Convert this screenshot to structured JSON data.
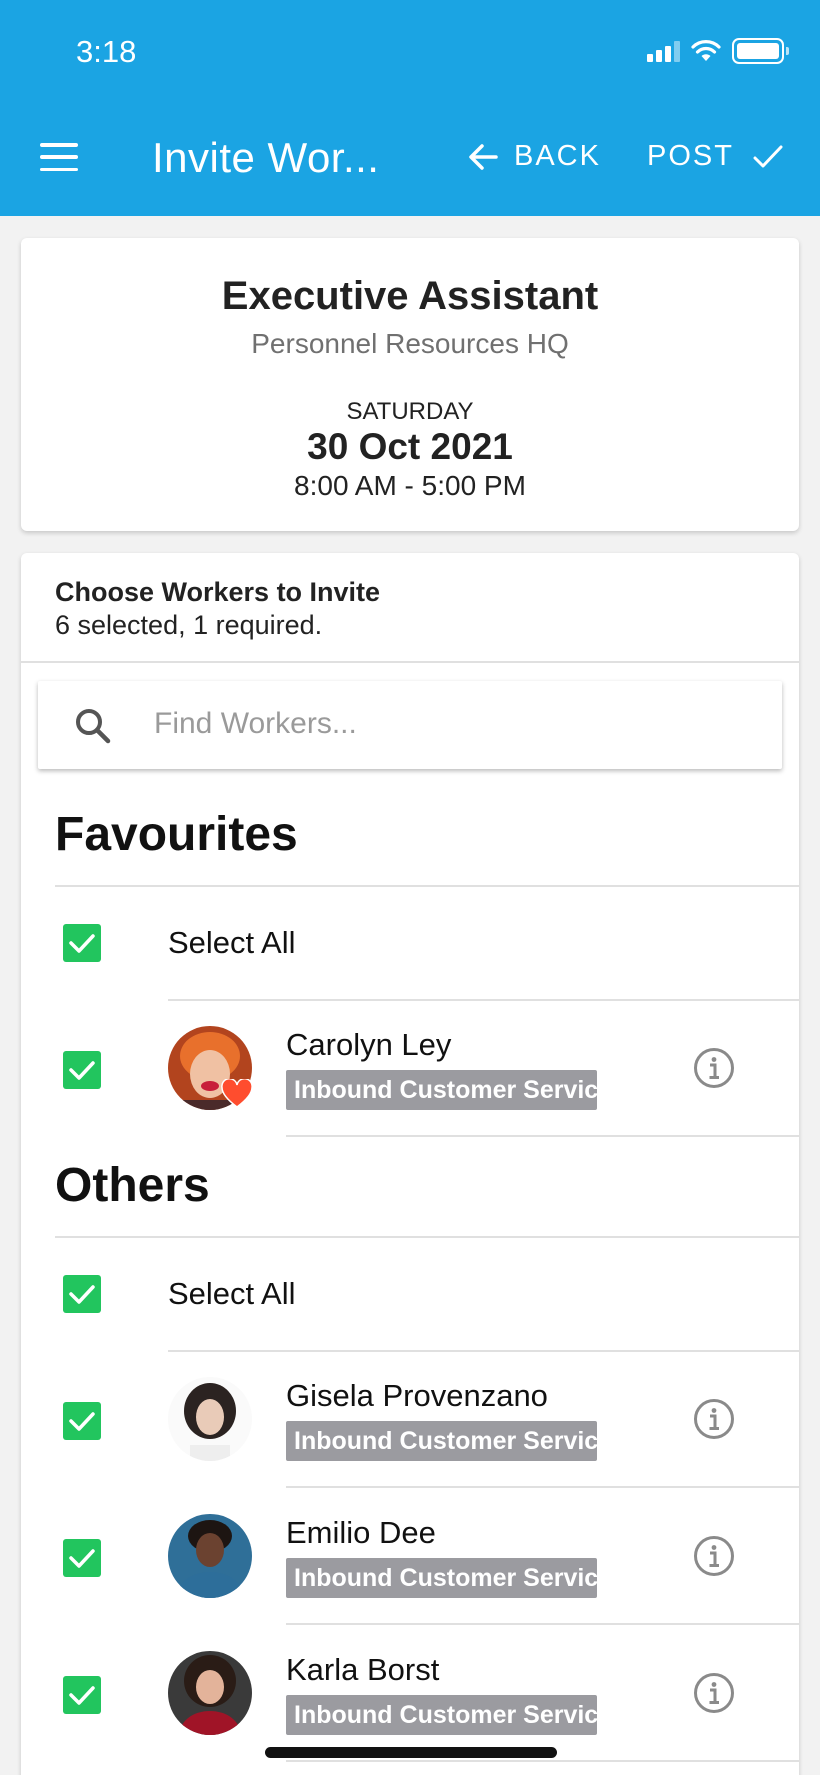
{
  "status_bar": {
    "time": "3:18"
  },
  "header": {
    "title": "Invite Wor...",
    "back_label": "BACK",
    "post_label": "POST"
  },
  "job": {
    "title": "Executive Assistant",
    "company": "Personnel Resources HQ",
    "day": "SATURDAY",
    "date": "30 Oct 2021",
    "time": "8:00 AM - 5:00 PM"
  },
  "workers_panel": {
    "title": "Choose Workers to Invite",
    "subtitle": "6 selected, 1 required.",
    "search_placeholder": "Find Workers..."
  },
  "favourites": {
    "heading": "Favourites",
    "select_all_label": "Select All",
    "workers": [
      {
        "name": "Carolyn Ley",
        "tag": "Inbound Customer Service",
        "favourite": true,
        "checked": true
      }
    ]
  },
  "others": {
    "heading": "Others",
    "select_all_label": "Select All",
    "workers": [
      {
        "name": "Gisela Provenzano",
        "tag": "Inbound Customer Service",
        "checked": true
      },
      {
        "name": "Emilio Dee",
        "tag": "Inbound Customer Service",
        "checked": true
      },
      {
        "name": "Karla Borst",
        "tag": "Inbound Customer Service",
        "checked": true
      }
    ]
  },
  "colors": {
    "header_bg": "#1ba4e3",
    "checkbox_green": "#22c55e",
    "tag_gray": "#9b9ba0",
    "heart_red": "#ff4d2e"
  }
}
